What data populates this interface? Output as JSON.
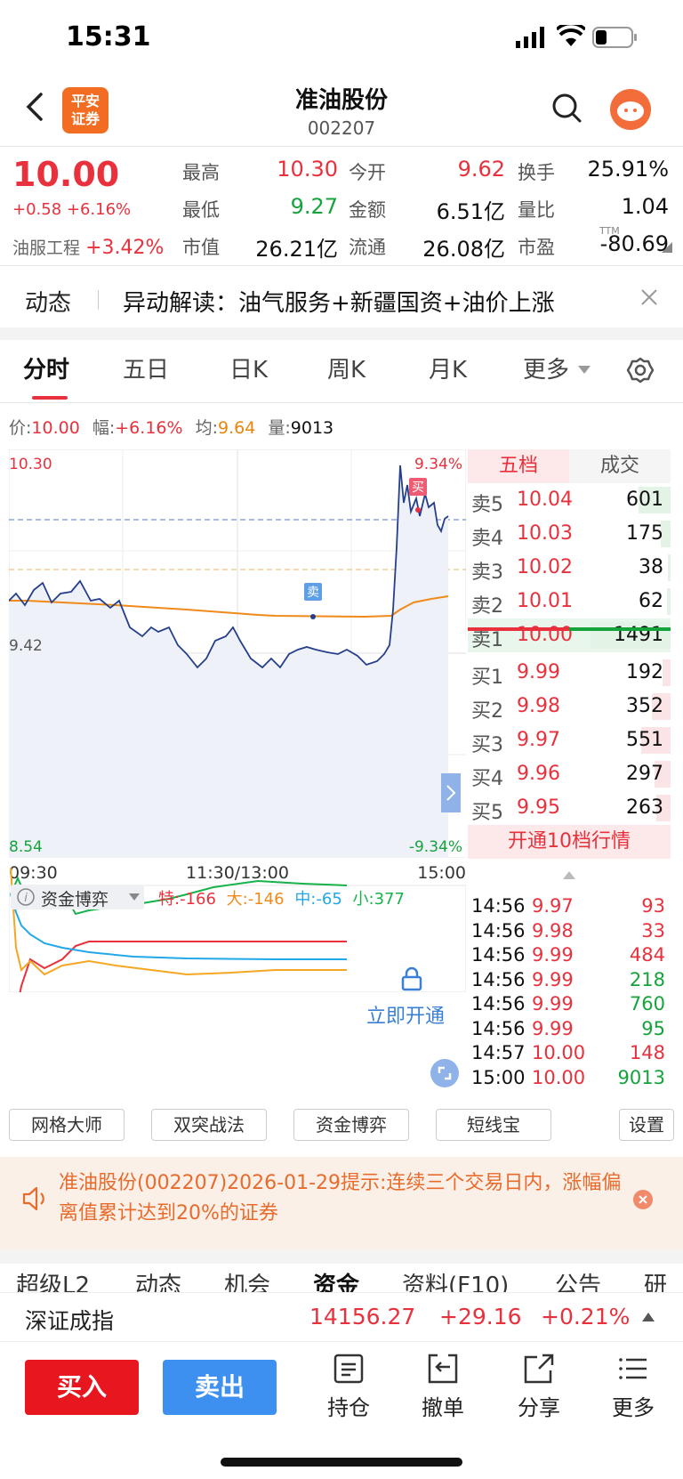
{
  "status": {
    "time": "15:31"
  },
  "header": {
    "logo_line1": "平安",
    "logo_line2": "证券",
    "title": "准油股份",
    "code": "002207"
  },
  "quote": {
    "price": "10.00",
    "change": "+0.58 +6.16%",
    "industry": "油服工程",
    "industry_change": "+3.42%",
    "fields": [
      {
        "label": "最高",
        "value": "10.30",
        "color": "red"
      },
      {
        "label": "今开",
        "value": "9.62",
        "color": "red"
      },
      {
        "label": "换手",
        "value": "25.91%",
        "color": "black"
      },
      {
        "label": "最低",
        "value": "9.27",
        "color": "green"
      },
      {
        "label": "金额",
        "value": "6.51亿",
        "color": "black"
      },
      {
        "label": "量比",
        "value": "1.04",
        "color": "black"
      },
      {
        "label": "市值",
        "value": "26.21亿",
        "color": "black"
      },
      {
        "label": "流通",
        "value": "26.08亿",
        "color": "black"
      },
      {
        "label": "市盈",
        "value": "-80.69",
        "color": "black"
      }
    ],
    "ttm": "TTM"
  },
  "news": {
    "tag": "动态",
    "text": "异动解读：油气服务+新疆国资+油价上涨"
  },
  "kline_tabs": [
    "分时",
    "五日",
    "日K",
    "周K",
    "月K",
    "更多"
  ],
  "info_line": {
    "price_label": "价:",
    "price": "10.00",
    "amp_label": "幅:",
    "amp": "+6.16%",
    "avg_label": "均:",
    "avg": "9.64",
    "vol_label": "量:",
    "vol": "9013"
  },
  "chart_labels": {
    "high": "10.30",
    "mid": "9.42",
    "low": "8.54",
    "high_pct": "9.34%",
    "low_pct": "-9.34%",
    "t_start": "09:30",
    "t_mid": "11:30/13:00",
    "t_end": "15:00",
    "buy_marker": "买",
    "sell_marker": "卖"
  },
  "fund_game": {
    "title": "资金博弈",
    "te": "特:-166",
    "da": "大:-146",
    "zhong": "中:-65",
    "xiao": "小:377",
    "unlock": "立即开通"
  },
  "orderbook": {
    "tabs": [
      "五档",
      "成交"
    ],
    "asks": [
      {
        "label": "卖5",
        "price": "10.04",
        "vol": "601",
        "bar": 0.4
      },
      {
        "label": "卖4",
        "price": "10.03",
        "vol": "175",
        "bar": 0.12
      },
      {
        "label": "卖3",
        "price": "10.02",
        "vol": "38",
        "bar": 0.03
      },
      {
        "label": "卖2",
        "price": "10.01",
        "vol": "62",
        "bar": 0.04
      },
      {
        "label": "卖1",
        "price": "10.00",
        "vol": "1491",
        "bar": 1.0
      }
    ],
    "bids": [
      {
        "label": "买1",
        "price": "9.99",
        "vol": "192",
        "bar": 0.1
      },
      {
        "label": "买2",
        "price": "9.98",
        "vol": "352",
        "bar": 0.23
      },
      {
        "label": "买3",
        "price": "9.97",
        "vol": "551",
        "bar": 0.37
      },
      {
        "label": "买4",
        "price": "9.96",
        "vol": "297",
        "bar": 0.2
      },
      {
        "label": "买5",
        "price": "9.95",
        "vol": "263",
        "bar": 0.18
      }
    ],
    "open10": "开通10档行情"
  },
  "ticks": [
    {
      "time": "14:56",
      "price": "9.97",
      "vol": "93",
      "color": "red"
    },
    {
      "time": "14:56",
      "price": "9.98",
      "vol": "33",
      "color": "red"
    },
    {
      "time": "14:56",
      "price": "9.99",
      "vol": "484",
      "color": "red"
    },
    {
      "time": "14:56",
      "price": "9.99",
      "vol": "218",
      "color": "green"
    },
    {
      "time": "14:56",
      "price": "9.99",
      "vol": "760",
      "color": "green"
    },
    {
      "time": "14:56",
      "price": "9.99",
      "vol": "95",
      "color": "green"
    },
    {
      "time": "14:57",
      "price": "10.00",
      "vol": "148",
      "color": "red"
    },
    {
      "time": "15:00",
      "price": "10.00",
      "vol": "9013",
      "color": "green"
    }
  ],
  "tools": [
    "网格大师",
    "双突战法",
    "资金博弈",
    "短线宝",
    "设置"
  ],
  "notice": "准油股份(002207)2026-01-29提示:连续三个交易日内，涨幅偏离值累计达到20%的证券",
  "bottom_tabs": [
    "超级L2",
    "动态",
    "机会",
    "资金",
    "资料(F10)",
    "公告",
    "研报"
  ],
  "index": {
    "name": "深证成指",
    "value": "14156.27",
    "change": "+29.16",
    "pct": "+0.21%"
  },
  "actions": {
    "buy": "买入",
    "sell": "卖出",
    "hold": "持仓",
    "cancel": "撤单",
    "share": "分享",
    "more": "更多"
  }
}
